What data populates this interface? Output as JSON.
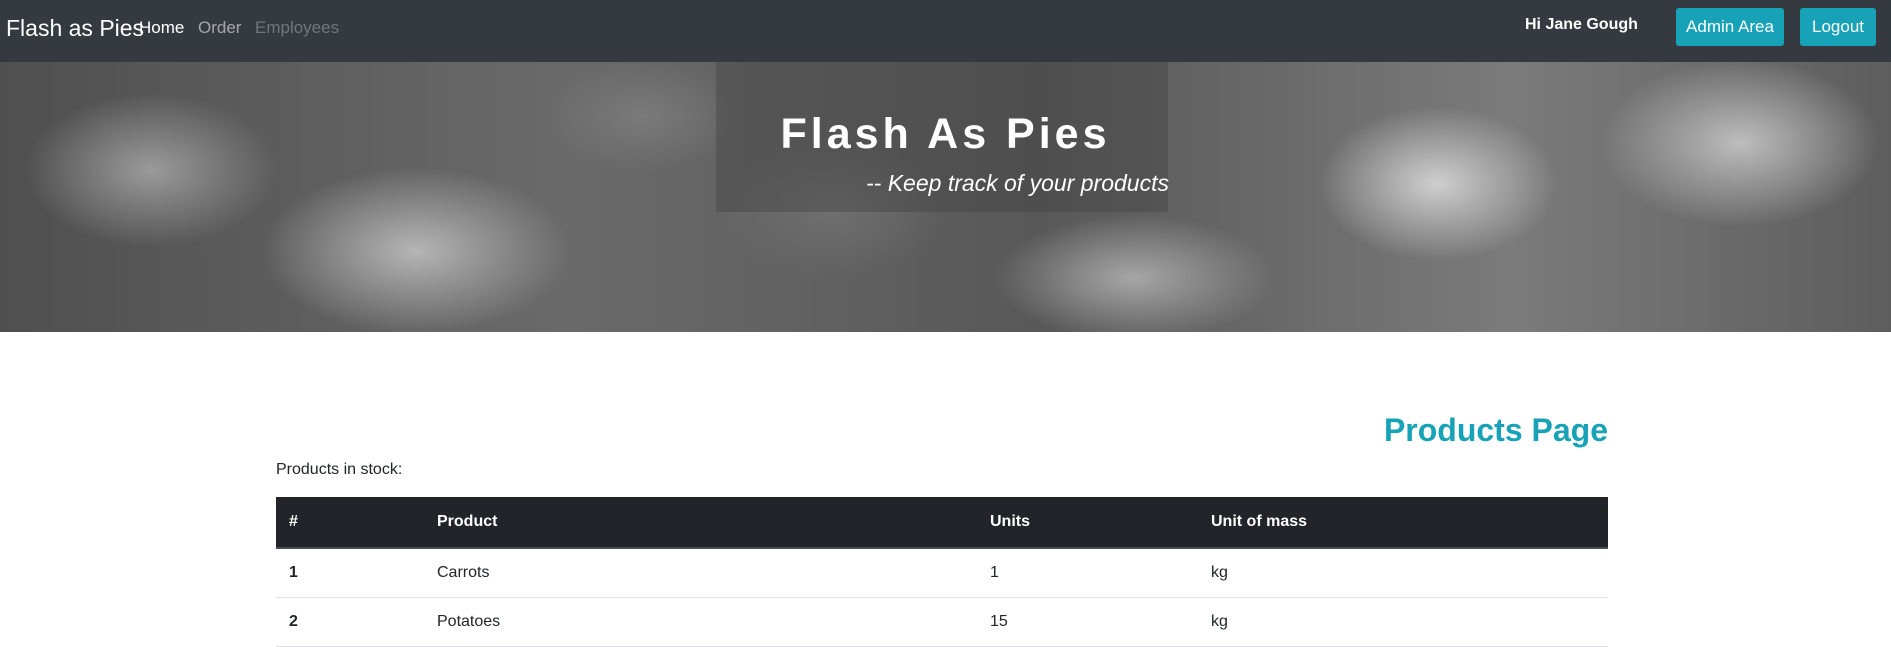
{
  "navbar": {
    "brand": "Flash as Pies",
    "links": [
      {
        "label": "Home",
        "state": "active"
      },
      {
        "label": "Order",
        "state": "normal"
      },
      {
        "label": "Employees",
        "state": "disabled"
      }
    ],
    "greeting": "Hi Jane Gough",
    "admin_button": "Admin Area",
    "logout_button": "Logout"
  },
  "hero": {
    "title": "Flash As Pies",
    "subtitle": "-- Keep track of your products"
  },
  "main": {
    "page_title": "Products Page",
    "stock_label": "Products in stock:",
    "table": {
      "columns": [
        "#",
        "Product",
        "Units",
        "Unit of mass"
      ],
      "rows": [
        {
          "num": "1",
          "product": "Carrots",
          "units": "1",
          "unit_of_mass": "kg"
        },
        {
          "num": "2",
          "product": "Potatoes",
          "units": "15",
          "unit_of_mass": "kg"
        }
      ]
    }
  },
  "colors": {
    "navbar_bg": "#343a40",
    "accent": "#17a2b8",
    "table_header_bg": "#212529"
  }
}
